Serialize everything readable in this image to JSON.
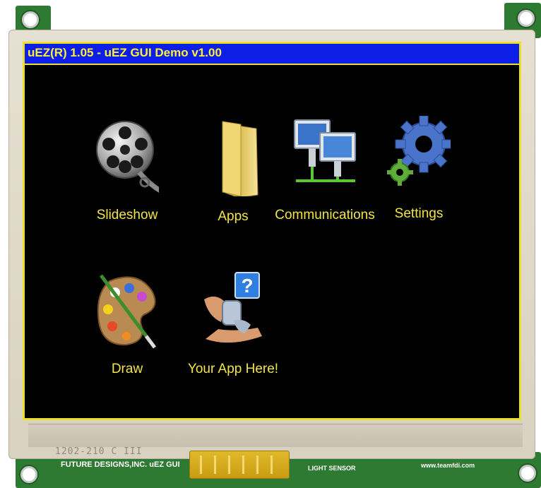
{
  "window": {
    "title": "uEZ(R) 1.05 - uEZ GUI Demo v1.00"
  },
  "apps": [
    {
      "label": "Slideshow",
      "icon": "film-reel-icon"
    },
    {
      "label": "Apps",
      "icon": "folder-icon"
    },
    {
      "label": "Communications",
      "icon": "network-computers-icon"
    },
    {
      "label": "Settings",
      "icon": "gears-icon"
    },
    {
      "label": "Draw",
      "icon": "paint-palette-icon"
    },
    {
      "label": "Your App Here!",
      "icon": "custom-app-icon"
    }
  ],
  "hardware": {
    "bezel_print": "1202-210   C III",
    "company_silkscreen": "FUTURE DESIGNS,INC.  uEZ GUI",
    "sensor_silkscreen": "LIGHT SENSOR",
    "url_silkscreen": "www.teamfdi.com"
  },
  "colors": {
    "title_bar": "#0d1fe6",
    "title_text": "#ffef3a",
    "label_text": "#f2e544",
    "screen_border": "#ece02a",
    "screen_bg": "#000000",
    "pcb": "#2f7a33"
  }
}
